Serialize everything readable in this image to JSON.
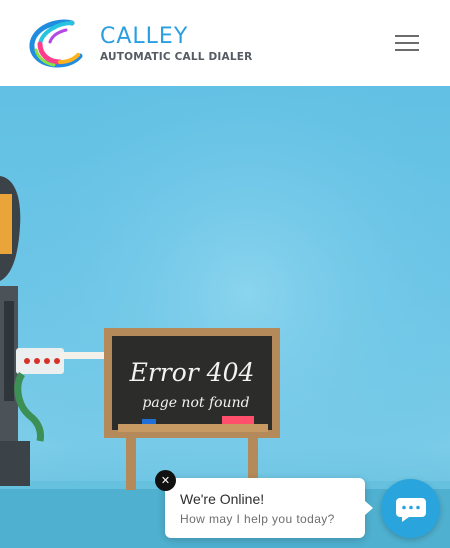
{
  "header": {
    "brand_name": "CALLEY",
    "brand_tagline": "AUTOMATIC CALL DIALER",
    "logo_icon": "calley-swirl-logo-icon",
    "menu_icon": "hamburger-menu-icon"
  },
  "hero": {
    "board_line1": "Error 404",
    "board_line2": "page not found",
    "background_color": "#6fc6e7"
  },
  "chat": {
    "title": "We're Online!",
    "subtitle": "How may I help you today?",
    "close_icon": "close-icon",
    "close_glyph": "✕",
    "launcher_icon": "chat-bubble-icon",
    "accent_color": "#2aa4dd"
  }
}
